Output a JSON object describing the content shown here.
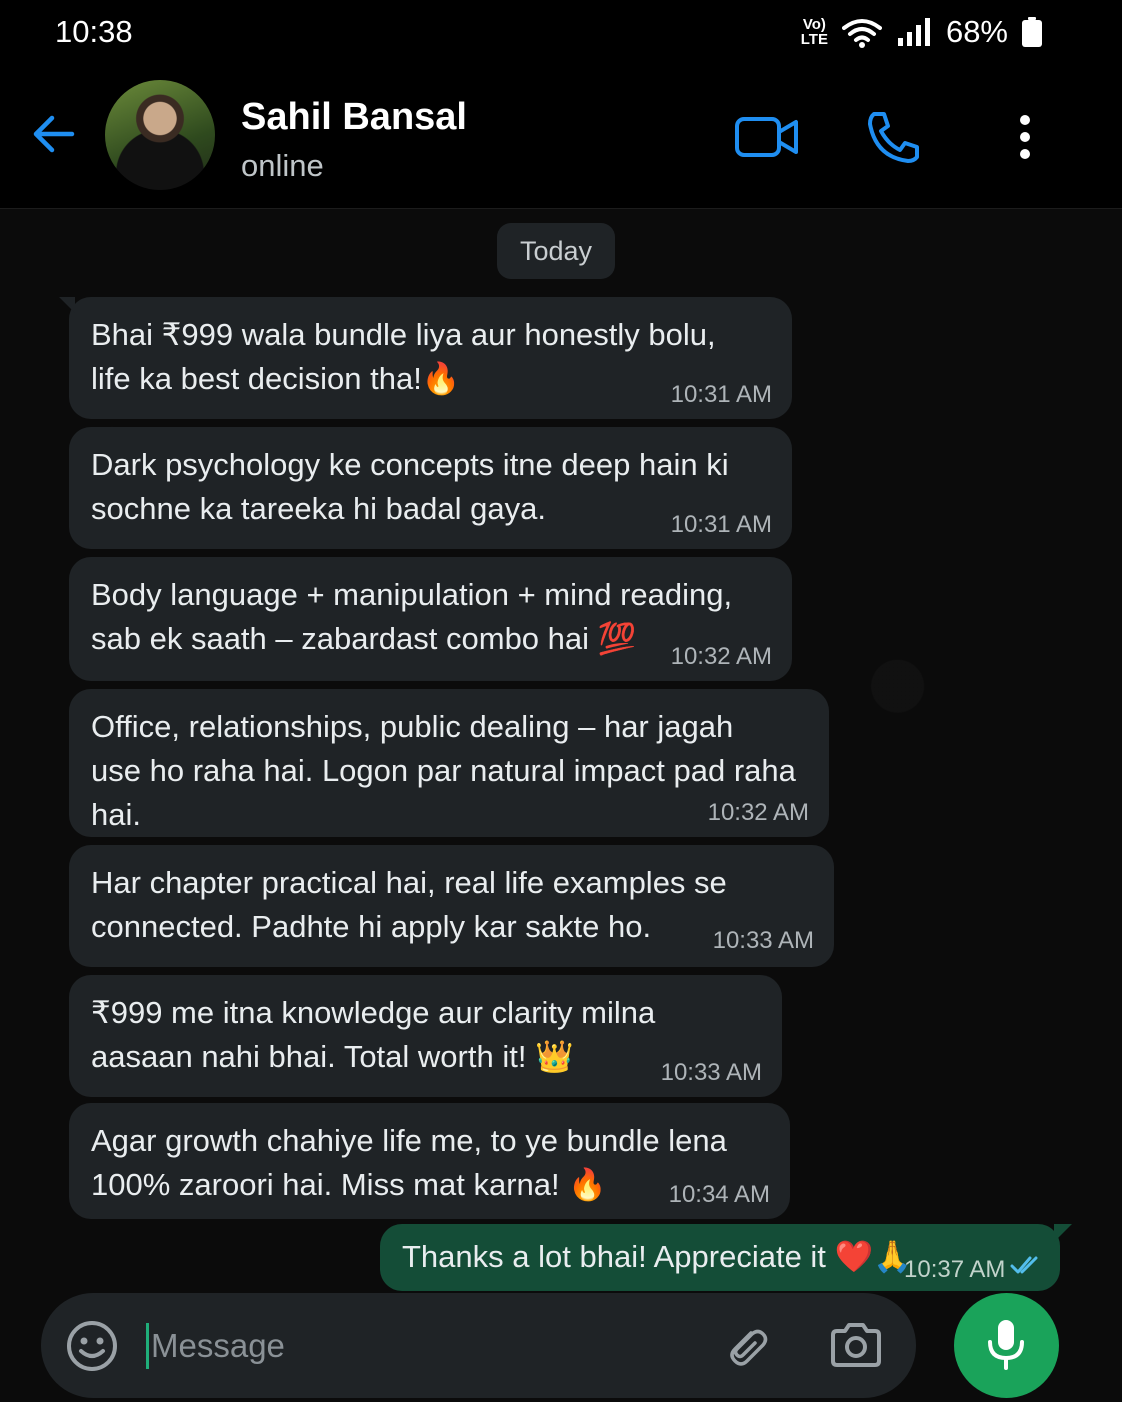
{
  "status_bar": {
    "time": "10:38",
    "network": "Vo)\nLTE",
    "battery": "68%"
  },
  "header": {
    "contact_name": "Sahil Bansal",
    "status": "online",
    "icons": [
      "back-arrow-icon",
      "video-call-icon",
      "voice-call-icon",
      "more-options-icon"
    ]
  },
  "chat": {
    "date_label": "Today",
    "incoming": [
      {
        "text": "Bhai ₹999 wala bundle liya aur honestly bolu,\nlife ka best decision tha!🔥",
        "time": "10:31 AM"
      },
      {
        "text": "Dark psychology ke concepts itne deep hain ki\nsochne ka tareeka hi badal gaya.",
        "time": "10:31 AM"
      },
      {
        "text": "Body language + manipulation + mind reading,\nsab ek saath – zabardast combo hai 💯",
        "time": "10:32 AM"
      },
      {
        "text": "Office, relationships, public dealing – har jagah\nuse ho raha hai. Logon par natural impact pad raha hai.",
        "time": "10:32 AM"
      },
      {
        "text": "Har chapter practical hai, real life examples se\nconnected. Padhte hi apply kar sakte ho.",
        "time": "10:33 AM"
      },
      {
        "text": "₹999 me itna knowledge aur clarity milna\naasaan nahi bhai. Total worth it! 👑",
        "time": "10:33 AM"
      },
      {
        "text": "Agar growth chahiye life me, to ye bundle lena\n100% zaroori hai. Miss mat karna! 🔥",
        "time": "10:34 AM"
      }
    ],
    "outgoing": {
      "text": "Thanks a lot bhai! Appreciate it ❤️🙏",
      "time": "10:37 AM",
      "status": "read"
    }
  },
  "composer": {
    "placeholder": "Message",
    "icons": [
      "emoji-icon",
      "attach-icon",
      "camera-icon",
      "mic-icon"
    ]
  },
  "colors": {
    "accent": "#1f8ef1",
    "outgoing_bubble": "#144d37",
    "mic_button": "#1aa35a"
  }
}
